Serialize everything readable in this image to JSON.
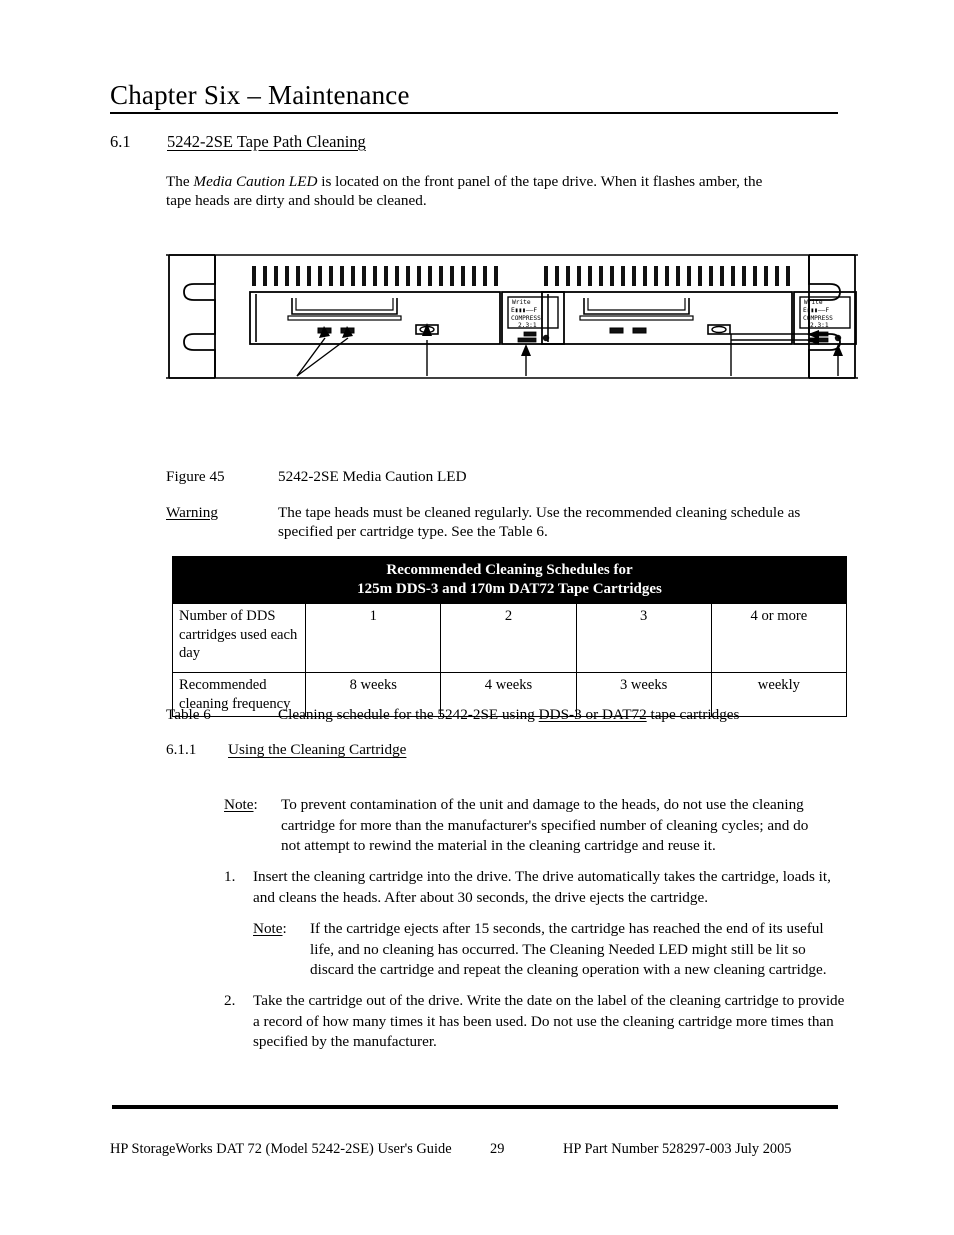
{
  "chapter": {
    "title": "Chapter Six – Maintenance"
  },
  "section": {
    "number": "6.1",
    "title": "5242-2SE Tape Path Cleaning"
  },
  "intro": {
    "before": "The ",
    "emphasis": "Media Caution LED",
    "after": " is located on the front panel of the tape drive. When it flashes amber, the tape heads are dirty and should be cleaned."
  },
  "figure": {
    "lcd": {
      "line1": "Write",
      "line2": "E▮▮▮——F",
      "line3": "COMPRESS",
      "line4": "2.3:1"
    },
    "caption_label": "Figure 45",
    "caption_text": "5242-2SE Media Caution LED",
    "vent_slot_count": 24
  },
  "warning": {
    "label": "Warning",
    "text": "The tape heads must be cleaned regularly. Use the recommended cleaning schedule as specified per cartridge type. See the Table 6."
  },
  "table": {
    "header_line1": "Recommended Cleaning Schedules for",
    "header_line2": "125m DDS-3 and 170m DAT72 Tape Cartridges",
    "rows": [
      {
        "label": "Number  of DDS cartridges used each day",
        "values": [
          "1",
          "2",
          "3",
          "4 or more"
        ]
      },
      {
        "label": "Recommended cleaning frequency",
        "values": [
          "8 weeks",
          "4 weeks",
          "3 weeks",
          "weekly"
        ]
      }
    ],
    "caption_label": "Table 6",
    "caption_before": "Cleaning schedule for the 5242-2SE using ",
    "caption_underlined": "DDS-3 or DAT72",
    "caption_after": " tape cartridges"
  },
  "subsection": {
    "number": "6.1.1",
    "title": "Using the Cleaning Cartridge"
  },
  "note1": {
    "label": "Note",
    "colon": ":",
    "text": "To prevent contamination of the unit and damage to the heads, do not use the cleaning cartridge for more than the manufacturer's specified number of cleaning cycles; and do not attempt to rewind the material in the cleaning cartridge and reuse it."
  },
  "item1": {
    "number": "1.",
    "text": "Insert the cleaning cartridge into the drive. The drive automatically takes the cartridge, loads it, and cleans the heads. After about 30 seconds, the drive ejects the cartridge."
  },
  "note2": {
    "label": "Note",
    "colon": ":",
    "text": "If the cartridge ejects after 15 seconds, the cartridge has reached the end of its useful life, and no cleaning has occurred. The Cleaning Needed LED might still be lit so discard the cartridge and repeat the cleaning operation with a new cleaning cartridge."
  },
  "item2": {
    "number": "2.",
    "text": "Take the cartridge out of the drive. Write the date on the label of the cleaning cartridge to provide a record of how many times it has been used. Do not use the cleaning cartridge more times than specified by the manufacturer."
  },
  "footer": {
    "left": "HP StorageWorks DAT 72 (Model 5242-2SE) User's Guide",
    "page": "29",
    "right": "HP Part Number 528297-003   July 2005"
  }
}
